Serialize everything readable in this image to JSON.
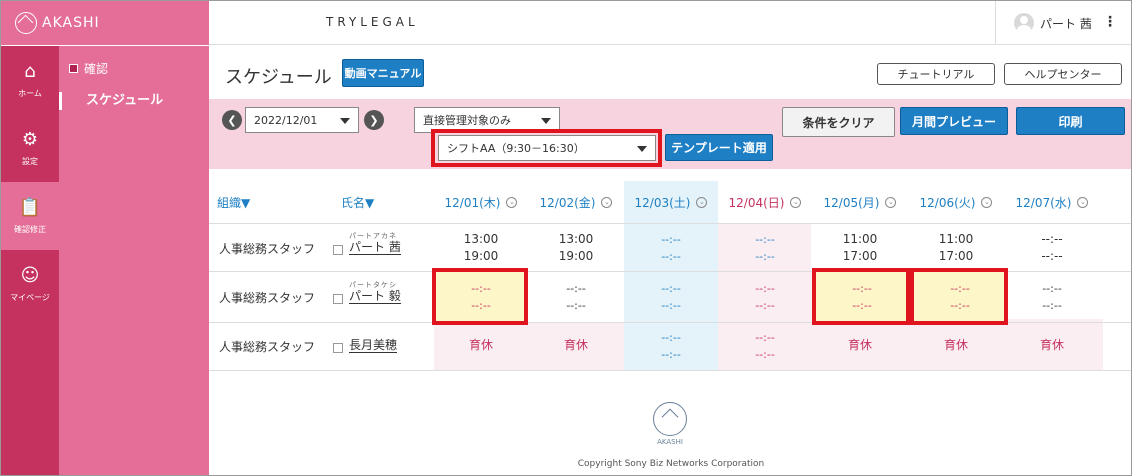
{
  "brand": "AKASHI",
  "company": "TRYLEGAL",
  "user": {
    "name": "パート 茜"
  },
  "nav": [
    {
      "label": "ホーム",
      "icon": "home-icon"
    },
    {
      "label": "設定",
      "icon": "gear-icon"
    },
    {
      "label": "確認修正",
      "icon": "clipboard-icon"
    },
    {
      "label": "マイページ",
      "icon": "person-icon"
    }
  ],
  "subnav": {
    "section": "確認",
    "item": "スケジュール"
  },
  "page": {
    "title": "スケジュール",
    "manual_label": "動画マニュアル",
    "tutorial_label": "チュートリアル",
    "help_label": "ヘルプセンター"
  },
  "filters": {
    "date": "2022/12/01",
    "scope": "直接管理対象のみ",
    "shift_template": "シフトAA（9:30－16:30）",
    "apply_label": "テンプレート適用",
    "clear_label": "条件をクリア",
    "preview_label": "月間プレビュー",
    "print_label": "印刷"
  },
  "table": {
    "headers": {
      "org": "組織▼",
      "name": "氏名▼"
    },
    "dates": [
      "12/01(木)",
      "12/02(金)",
      "12/03(土)",
      "12/04(日)",
      "12/05(月)",
      "12/06(火)",
      "12/07(水)"
    ],
    "rows": [
      {
        "dept": "人事総務スタッフ",
        "kana": "パートアカネ",
        "name": "パート 茜",
        "cells": [
          [
            "13:00",
            "19:00"
          ],
          [
            "13:00",
            "19:00"
          ],
          [
            "--:--",
            "--:--"
          ],
          [
            "--:--",
            "--:--"
          ],
          [
            "11:00",
            "17:00"
          ],
          [
            "11:00",
            "17:00"
          ],
          [
            "--:--",
            "--:--"
          ]
        ]
      },
      {
        "dept": "人事総務スタッフ",
        "kana": "パートタケシ",
        "name": "パート 毅",
        "cells": [
          [
            "--:--",
            "--:--"
          ],
          [
            "--:--",
            "--:--"
          ],
          [
            "--:--",
            "--:--"
          ],
          [
            "--:--",
            "--:--"
          ],
          [
            "--:--",
            "--:--"
          ],
          [
            "--:--",
            "--:--"
          ],
          [
            "--:--",
            "--:--"
          ]
        ]
      },
      {
        "dept": "人事総務スタッフ",
        "kana": "",
        "name": "長月美穂",
        "cells": [
          [
            "育休"
          ],
          [
            "育休"
          ],
          [
            "--:--",
            "--:--"
          ],
          [
            "--:--",
            "--:--"
          ],
          [
            "育休"
          ],
          [
            "育休"
          ],
          [
            "育休"
          ]
        ]
      }
    ]
  },
  "footer": {
    "logo_word": "AKASHI",
    "copyright": "Copyright Sony Biz Networks Corporation"
  }
}
